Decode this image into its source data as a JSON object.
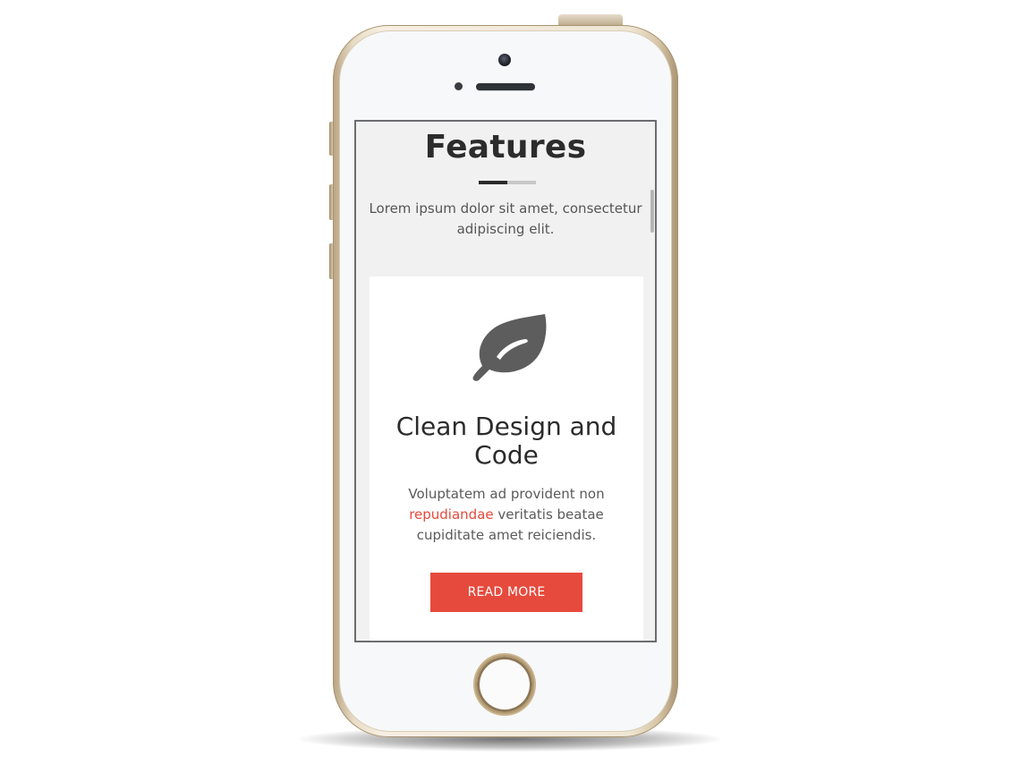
{
  "section": {
    "title": "Features",
    "intro": "Lorem ipsum dolor sit amet, consectetur adipiscing elit."
  },
  "card": {
    "icon": "leaf-icon",
    "title": "Clean Design and Code",
    "text_before": "Voluptatem ad provident non ",
    "link_text": "repudiandae",
    "text_after": " veritatis beatae cupiditate amet reiciendis.",
    "button_label": "READ MORE"
  },
  "colors": {
    "accent": "#e64a3d",
    "heading": "#2c2c2c",
    "icon": "#5d5d5d"
  }
}
